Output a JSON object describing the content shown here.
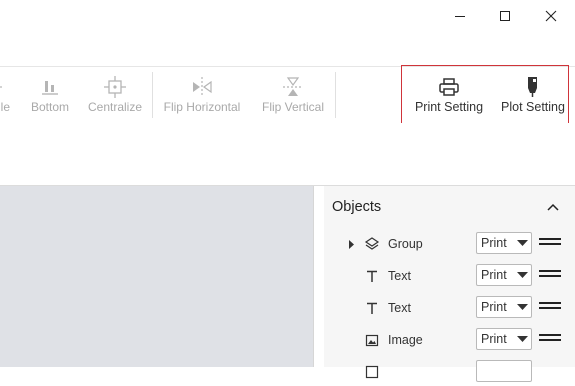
{
  "window": {
    "controls": [
      "minimize-icon",
      "maximize-icon",
      "close-icon"
    ]
  },
  "toolbar": {
    "items": [
      {
        "label": "lle",
        "icon": "align-middle-icon",
        "enabled": false
      },
      {
        "label": "Bottom",
        "icon": "align-bottom-icon",
        "enabled": false
      },
      {
        "label": "Centralize",
        "icon": "centralize-icon",
        "enabled": false
      },
      {
        "label": "Flip Horizontal",
        "icon": "flip-horizontal-icon",
        "enabled": false
      },
      {
        "label": "Flip Vertical",
        "icon": "flip-vertical-icon",
        "enabled": false
      },
      {
        "label": "Print Setting",
        "icon": "printer-icon",
        "enabled": true
      },
      {
        "label": "Plot Setting",
        "icon": "plotter-pen-icon",
        "enabled": true
      }
    ],
    "highlight_color": "#d0343a"
  },
  "canvas": {
    "background": "#dfe1e6"
  },
  "objects_panel": {
    "title": "Objects",
    "rows": [
      {
        "label": "Group",
        "icon": "layers-icon",
        "mode": "Print",
        "expandable": true
      },
      {
        "label": "Text",
        "icon": "text-icon",
        "mode": "Print",
        "expandable": false
      },
      {
        "label": "Text",
        "icon": "text-icon",
        "mode": "Print",
        "expandable": false
      },
      {
        "label": "Image",
        "icon": "image-icon",
        "mode": "Print",
        "expandable": false
      },
      {
        "label": "",
        "icon": "shape-icon",
        "mode": "",
        "expandable": false
      }
    ]
  }
}
